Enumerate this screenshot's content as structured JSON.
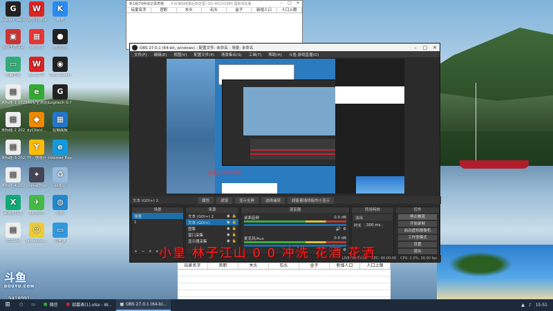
{
  "desktop": {
    "icons": [
      {
        "label": "bgbskr_beta...",
        "icon": "app-g",
        "color": "#222"
      },
      {
        "label": "WPS Office",
        "icon": "wps",
        "color": "#d22"
      },
      {
        "label": "酷狗",
        "icon": "k",
        "color": "#2a8bf2"
      },
      {
        "label": "多玩王牌平台",
        "icon": "app",
        "color": "#c33"
      },
      {
        "label": "360软件",
        "icon": "grid",
        "color": "#e33"
      },
      {
        "label": "腾讯QQ",
        "icon": "penguin",
        "color": "#222"
      },
      {
        "label": "电脑管家",
        "icon": "pc",
        "color": "#3a7"
      },
      {
        "label": "WPS文字",
        "icon": "w",
        "color": "#d22"
      },
      {
        "label": "OBS Studio",
        "icon": "obs",
        "color": "#222"
      },
      {
        "label": "未标题-1 2022/1",
        "icon": "doc",
        "color": "#eee"
      },
      {
        "label": "360安全浏览器",
        "icon": "e",
        "color": "#3a3"
      },
      {
        "label": "Logitech G HUB",
        "icon": "g",
        "color": "#222"
      },
      {
        "label": "未标题-2 2022/06",
        "icon": "doc",
        "color": "#eee"
      },
      {
        "label": "dyClient...",
        "icon": "fox",
        "color": "#e80"
      },
      {
        "label": "控制面板",
        "icon": "panel",
        "color": "#27c"
      },
      {
        "label": "未标题-3 2022/06",
        "icon": "doc",
        "color": "#eee"
      },
      {
        "label": "YY - 快速开",
        "icon": "yy",
        "color": "#fb0"
      },
      {
        "label": "Internet Explorer",
        "icon": "ie",
        "color": "#19d"
      },
      {
        "label": "未标题-4 2022/06",
        "icon": "doc",
        "color": "#eee"
      },
      {
        "label": "UnrealDrop",
        "icon": "ud",
        "color": "#445"
      },
      {
        "label": "回收站",
        "icon": "bin",
        "color": "#9bd"
      },
      {
        "label": "新建文件夹",
        "icon": "xls",
        "color": "#1a7"
      },
      {
        "label": "360WiFi",
        "icon": "wifi",
        "color": "#4b4"
      },
      {
        "label": "网络",
        "icon": "net",
        "color": "#28c"
      },
      {
        "label": "PS2 Vol",
        "icon": "doc",
        "color": "#eee"
      },
      {
        "label": "Jayrainbo...",
        "icon": "smile",
        "color": "#ec3"
      },
      {
        "label": "此电脑",
        "icon": "pc",
        "color": "#39d"
      }
    ],
    "douyu_logo": "斗鱼",
    "douyu_sub": "DOUYU.COM",
    "room_id": "9418991"
  },
  "excel_top": {
    "title": "新1版TN养成记录表格",
    "note": "4.6(相加结束后到这里)   QQ   4013/1885   国际领先版",
    "columns": [
      "玩家名字",
      "官职",
      "木头",
      "石头",
      "金子",
      "新增人口",
      "人口上限"
    ]
  },
  "obs": {
    "title": "OBS 27.0.1 (64-bit, windows) - 配置文件: 未命名 - 场景: 未命名",
    "menu": [
      "文件(F)",
      "编辑(E)",
      "视图(V)",
      "配置文件(P)",
      "场景集合(S)",
      "工具(T)",
      "帮助(H)",
      "斗鱼·游戏直播(D)"
    ],
    "preview_caption": "直播互动中心预告",
    "toolbar": {
      "source_name": "文本 (GDI+) 2",
      "properties": "属性",
      "filters": "滤镜",
      "source_btn1": "显示全屏",
      "source_btn2": "选择捕获",
      "source_label": "超能量插线板的小显示"
    },
    "docks": {
      "scenes": {
        "header": "场景",
        "items": [
          "场景",
          "1"
        ]
      },
      "sources": {
        "header": "来源",
        "items": [
          "文本 (GDI+) 2",
          "文本 (GDI+)",
          "图像",
          "窗口采集",
          "显示器采集"
        ]
      },
      "mixer": {
        "header": "混音器",
        "tracks": [
          {
            "name": "桌面音频",
            "db": "0.0 dB"
          },
          {
            "name": "麦克风/Aux",
            "db": "0.0 dB"
          }
        ]
      },
      "transitions": {
        "header": "转场特效",
        "type": "淡出",
        "duration_label": "时长",
        "duration": "300 ms"
      },
      "controls": {
        "header": "控件",
        "buttons": [
          "停止推流",
          "开始录制",
          "启动虚拟摄像机",
          "工作室模式",
          "设置",
          "退出"
        ]
      }
    },
    "status": {
      "live": "LIVE: 00:00:00",
      "rec": "REC: 00:00:00",
      "cpu": "CPU: 2.0%, 30.00 fps"
    }
  },
  "overlay_text": "小皇 林子江山 0 0 冲洗 花酒 花洒",
  "excel_bottom": {
    "columns": [
      "玩家名字",
      "官职",
      "木头",
      "石头",
      "金子",
      "新增人口",
      "人口上限"
    ]
  },
  "taskbar": {
    "tasks": [
      {
        "label": "微信",
        "active": false
      },
      {
        "label": "招募表(1).xlsx - W...",
        "active": false
      },
      {
        "label": "OBS 27.0.1 (64-bi...",
        "active": true
      }
    ],
    "tray": "15:51"
  }
}
